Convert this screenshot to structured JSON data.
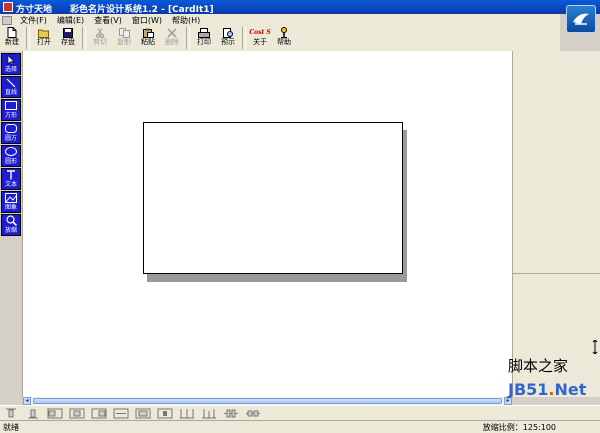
{
  "window": {
    "app_name": "方寸天地",
    "doc_title": "彩色名片设计系统1.2 - [CardIt1]"
  },
  "menu": {
    "items": [
      "文件(F)",
      "编辑(E)",
      "查看(V)",
      "窗口(W)",
      "帮助(H)"
    ]
  },
  "toolbar": {
    "buttons": [
      {
        "label": "新建",
        "icon": "new-file-icon",
        "enabled": true
      },
      {
        "label": "打开",
        "icon": "open-folder-icon",
        "enabled": true
      },
      {
        "label": "存盘",
        "icon": "save-disk-icon",
        "enabled": true
      },
      {
        "label": "剪切",
        "icon": "cut-icon",
        "enabled": false
      },
      {
        "label": "复制",
        "icon": "copy-icon",
        "enabled": false
      },
      {
        "label": "粘贴",
        "icon": "paste-icon",
        "enabled": true
      },
      {
        "label": "删除",
        "icon": "delete-icon",
        "enabled": false
      },
      {
        "label": "打印",
        "icon": "print-icon",
        "enabled": true
      },
      {
        "label": "预示",
        "icon": "preview-icon",
        "enabled": true
      },
      {
        "label": "关于",
        "icon": "about-icon",
        "enabled": true,
        "icon_text": "Cost S"
      },
      {
        "label": "帮助",
        "icon": "help-icon",
        "enabled": true
      }
    ]
  },
  "tools": [
    {
      "label": "选择",
      "icon": "select-arrow-icon"
    },
    {
      "label": "直线",
      "icon": "line-icon"
    },
    {
      "label": "方形",
      "icon": "rectangle-icon"
    },
    {
      "label": "圆方",
      "icon": "rounded-rect-icon"
    },
    {
      "label": "圆形",
      "icon": "ellipse-icon"
    },
    {
      "label": "文本",
      "icon": "text-icon"
    },
    {
      "label": "图象",
      "icon": "image-icon"
    },
    {
      "label": "放缩",
      "icon": "zoom-icon"
    }
  ],
  "statusbar": {
    "left": "就绪",
    "right": "放缩比例：125:100"
  },
  "watermark": {
    "line1": "脚本之家",
    "line2_a": "JB51",
    "line2_dot": ".",
    "line2_b": "Net"
  },
  "colors": {
    "title_bar": "#0b46bf",
    "tool_button": "#1c1cd0",
    "chrome": "#ece9d8",
    "canvas": "#ffffff",
    "card_shadow": "#9a9a9a"
  }
}
